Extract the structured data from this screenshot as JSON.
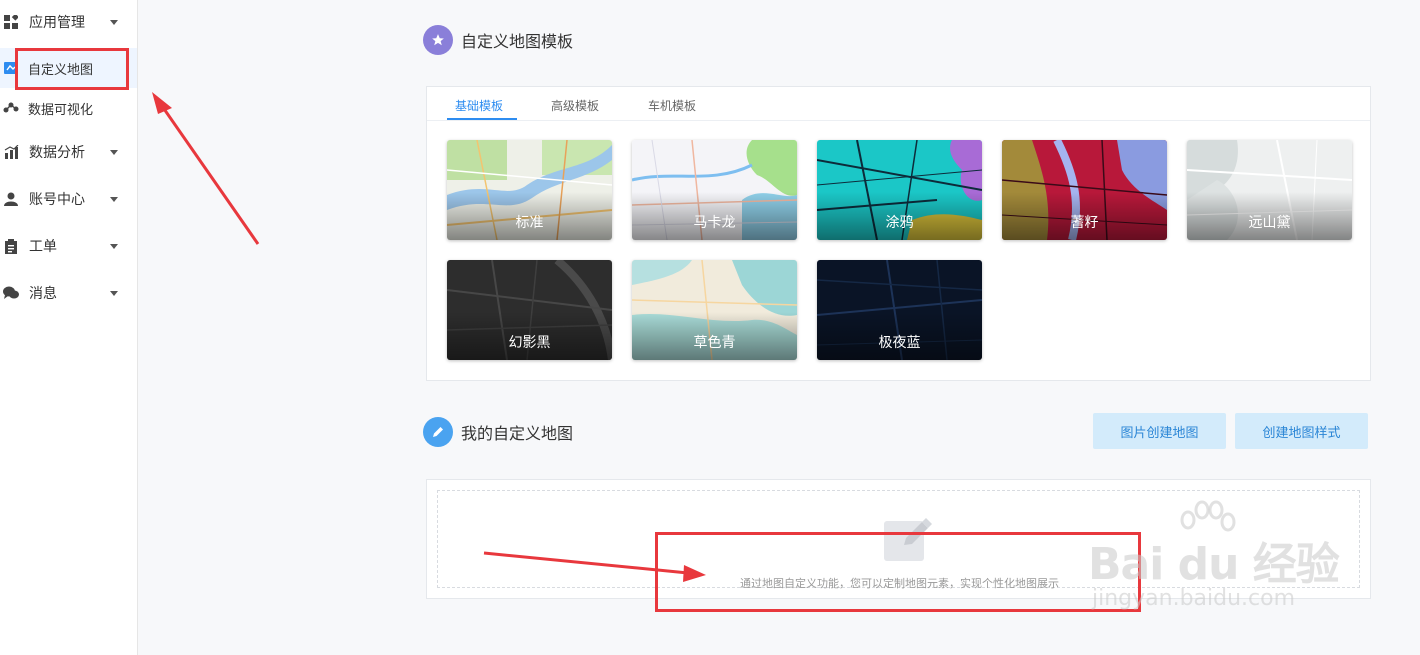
{
  "sidebar": {
    "items": [
      {
        "label": "应用管理",
        "icon": "apps-icon",
        "has_caret": true
      },
      {
        "label": "自定义地图",
        "icon": "custom-map-icon",
        "has_caret": false,
        "active": true
      },
      {
        "label": "数据可视化",
        "icon": "data-visualization-icon",
        "has_caret": false
      },
      {
        "label": "数据分析",
        "icon": "bar-chart-icon",
        "has_caret": true
      },
      {
        "label": "账号中心",
        "icon": "user-icon",
        "has_caret": true
      },
      {
        "label": "工单",
        "icon": "clipboard-icon",
        "has_caret": true
      },
      {
        "label": "消息",
        "icon": "chat-icon",
        "has_caret": true
      }
    ]
  },
  "templates_section": {
    "title": "自定义地图模板",
    "icon": "star-icon",
    "icon_color": "#8a7fd9",
    "tabs": [
      {
        "label": "基础模板",
        "active": true
      },
      {
        "label": "高级模板",
        "active": false
      },
      {
        "label": "车机模板",
        "active": false
      }
    ],
    "templates": [
      {
        "name": "标准",
        "style": "standard"
      },
      {
        "name": "马卡龙",
        "style": "macaron"
      },
      {
        "name": "涂鸦",
        "style": "graffiti"
      },
      {
        "name": "蓍籽",
        "style": "seed"
      },
      {
        "name": "远山黛",
        "style": "mountain"
      },
      {
        "name": "幻影黑",
        "style": "phantom-black"
      },
      {
        "name": "草色青",
        "style": "grass-green"
      },
      {
        "name": "极夜蓝",
        "style": "polar-night-blue"
      }
    ]
  },
  "my_maps_section": {
    "title": "我的自定义地图",
    "icon": "pencil-icon",
    "icon_color": "#4aa3f0",
    "buttons": {
      "create_from_image": "图片创建地图",
      "create_style": "创建地图样式"
    },
    "empty_text": "通过地图自定义功能，您可以定制地图元素，实现个性化地图展示"
  },
  "watermark": {
    "brand": "Bai du 经验",
    "url": "jingyan.baidu.com"
  },
  "colors": {
    "accent": "#2d8cf0",
    "button_bg": "#d3ebfb",
    "button_text": "#2b86d6",
    "highlight_red": "#e8383d"
  }
}
